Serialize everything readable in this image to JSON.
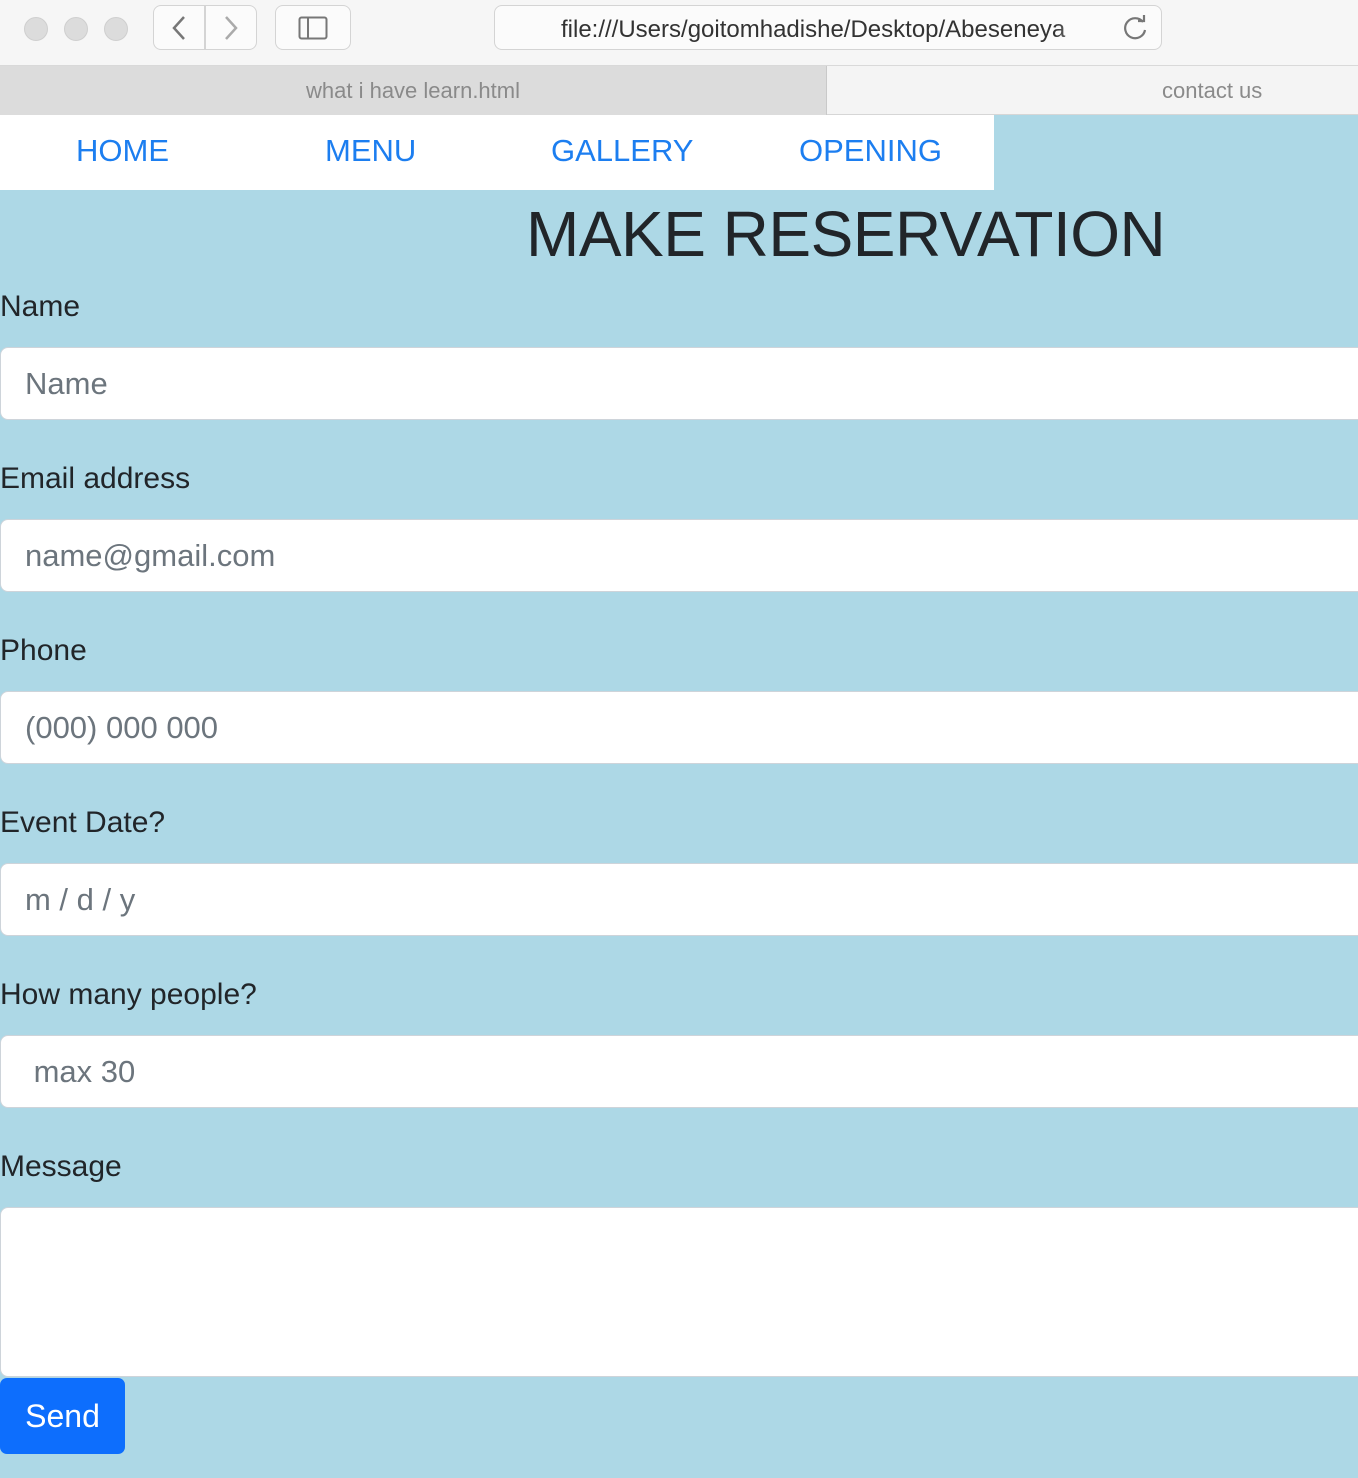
{
  "browser": {
    "url": "file:///Users/goitomhadishe/Desktop/Abeseneya",
    "tabs": [
      {
        "label": "what i have learn.html"
      },
      {
        "label": "contact us"
      }
    ]
  },
  "nav": {
    "items": [
      {
        "label": "HOME"
      },
      {
        "label": "MENU"
      },
      {
        "label": "GALLERY"
      },
      {
        "label": "OPENING"
      }
    ]
  },
  "form": {
    "title": "MAKE RESERVATION",
    "name": {
      "label": "Name",
      "placeholder": "Name"
    },
    "email": {
      "label": "Email address",
      "placeholder": "name@gmail.com"
    },
    "phone": {
      "label": "Phone",
      "placeholder": "(000) 000 000"
    },
    "date": {
      "label": "Event Date?",
      "placeholder": "m / d / y"
    },
    "people": {
      "label": "How many people?",
      "placeholder": " max 30"
    },
    "message": {
      "label": "Message",
      "placeholder": ""
    },
    "send_label": "Send"
  },
  "colors": {
    "page_background": "#add8e6",
    "nav_link": "#1c7ef0",
    "send_button": "#0d6efd"
  }
}
